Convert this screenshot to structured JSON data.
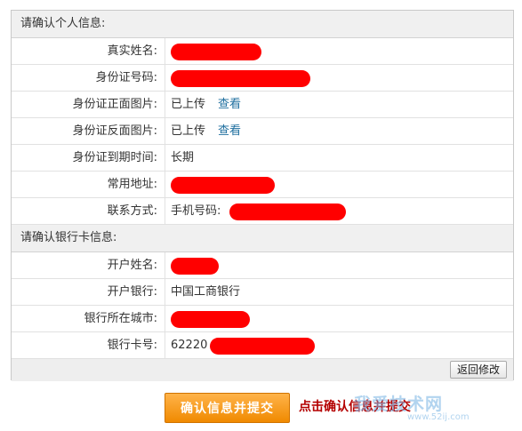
{
  "personal": {
    "heading": "请确认个人信息:",
    "rows": [
      {
        "label": "真实姓名:",
        "value": ""
      },
      {
        "label": "身份证号码:",
        "value": ""
      },
      {
        "label": "身份证正面图片:",
        "value": "已上传",
        "link": "查看"
      },
      {
        "label": "身份证反面图片:",
        "value": "已上传",
        "link": "查看"
      },
      {
        "label": "身份证到期时间:",
        "value": "长期"
      },
      {
        "label": "常用地址:",
        "value": ""
      },
      {
        "label": "联系方式:",
        "value": "手机号码:"
      }
    ]
  },
  "bank": {
    "heading": "请确认银行卡信息:",
    "rows": [
      {
        "label": "开户姓名:",
        "value": ""
      },
      {
        "label": "开户银行:",
        "value": "中国工商银行"
      },
      {
        "label": "银行所在城市:",
        "value": ""
      },
      {
        "label": "银行卡号:",
        "value": "62220"
      }
    ]
  },
  "actions": {
    "back_label": "返回修改",
    "confirm_label": "确认信息并提交",
    "confirm_hint": "点击确认信息并提交"
  },
  "watermark": {
    "text": "我爱技术网",
    "url": "www.52ij.com"
  },
  "colors": {
    "redaction": "#ff0000",
    "confirm_button": "#f59a1a",
    "hint_text": "#b40000",
    "link": "#1f6f9f"
  }
}
